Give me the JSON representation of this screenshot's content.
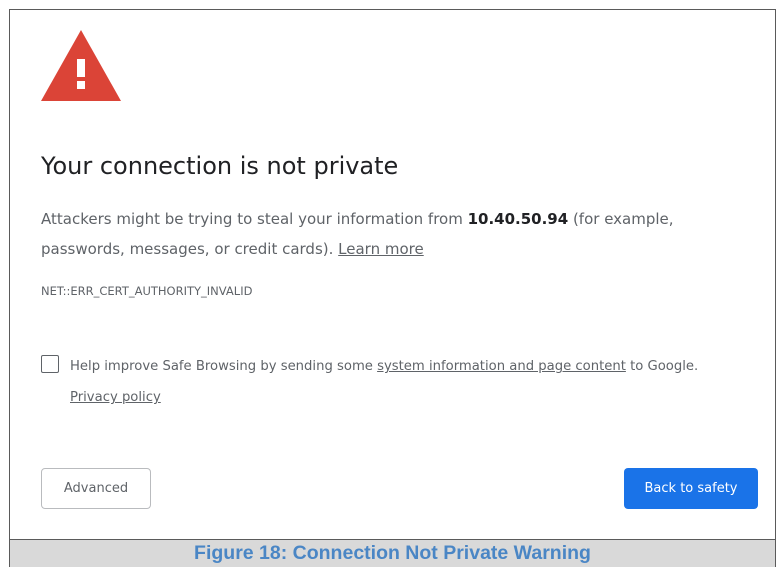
{
  "page": {
    "heading": "Your connection is not private",
    "body_before_host": "Attackers might be trying to steal your information from ",
    "host": "10.40.50.94",
    "body_after_host": " (for example, passwords, messages, or credit cards). ",
    "learn_more": "Learn more",
    "error_code": "NET::ERR_CERT_AUTHORITY_INVALID",
    "icon": "warning-triangle-icon"
  },
  "optin": {
    "checked": false,
    "text_before_link": "Help improve Safe Browsing by sending some ",
    "link": "system information and page content",
    "text_after_link": " to Google.",
    "privacy_policy": "Privacy policy"
  },
  "buttons": {
    "advanced_label": "Advanced",
    "back_label": "Back to safety"
  },
  "caption": {
    "text": "Figure 18: Connection Not Private Warning"
  },
  "colors": {
    "warning_red": "#db4437",
    "primary_blue": "#1a73e8",
    "caption_blue": "#4a86c5",
    "caption_bg": "#d9d9d9"
  }
}
